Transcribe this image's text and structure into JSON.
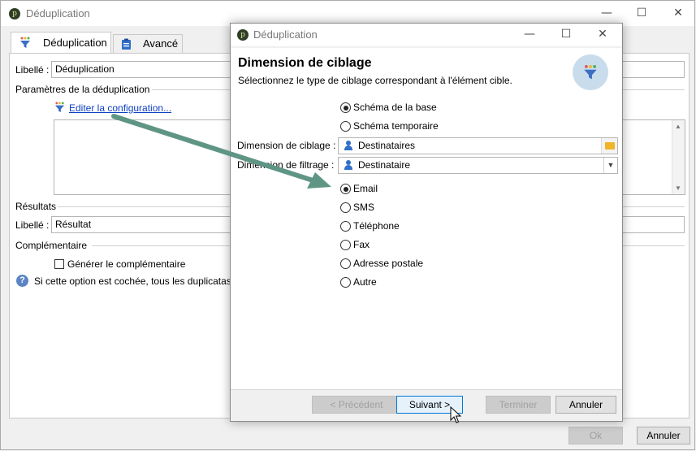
{
  "main_window": {
    "title": "Déduplication",
    "tabs": [
      {
        "label": "Déduplication",
        "active": true
      },
      {
        "label": "Avancé",
        "active": false
      }
    ],
    "label_caption": "Libellé :",
    "label_value": "Déduplication",
    "params_section": "Paramètres de la déduplication",
    "edit_config_link": "Editer la configuration...",
    "results_section": "Résultats",
    "result_label_caption": "Libellé :",
    "result_label_value": "Résultat",
    "complement_section": "Complémentaire",
    "generate_complement_label": "Générer le complémentaire",
    "generate_complement_checked": false,
    "help_text": "Si cette option est cochée, tous les duplicatas",
    "ok_button": "Ok",
    "cancel_button": "Annuler"
  },
  "dialog": {
    "title": "Déduplication",
    "header_title": "Dimension de ciblage",
    "header_subtitle": "Sélectionnez le type de ciblage correspondant à l'élément cible.",
    "schema_options": [
      {
        "label": "Schéma de la base",
        "checked": true
      },
      {
        "label": "Schéma temporaire",
        "checked": false
      }
    ],
    "targeting_dimension_label": "Dimension de ciblage :",
    "targeting_dimension_value": "Destinataires",
    "filtering_dimension_label": "Dimension de filtrage :",
    "filtering_dimension_value": "Destinataire",
    "channel_options": [
      {
        "label": "Email",
        "checked": true
      },
      {
        "label": "SMS",
        "checked": false
      },
      {
        "label": "Téléphone",
        "checked": false
      },
      {
        "label": "Fax",
        "checked": false
      },
      {
        "label": "Adresse postale",
        "checked": false
      },
      {
        "label": "Autre",
        "checked": false
      }
    ],
    "buttons": {
      "previous": "< Précédent",
      "next": "Suivant >",
      "finish": "Terminer",
      "cancel": "Annuler"
    }
  },
  "colors": {
    "accent": "#0078d7",
    "link": "#0b3fc1",
    "annotation_arrow": "#5f9585",
    "funnel_icon": "#3a6fc4"
  }
}
